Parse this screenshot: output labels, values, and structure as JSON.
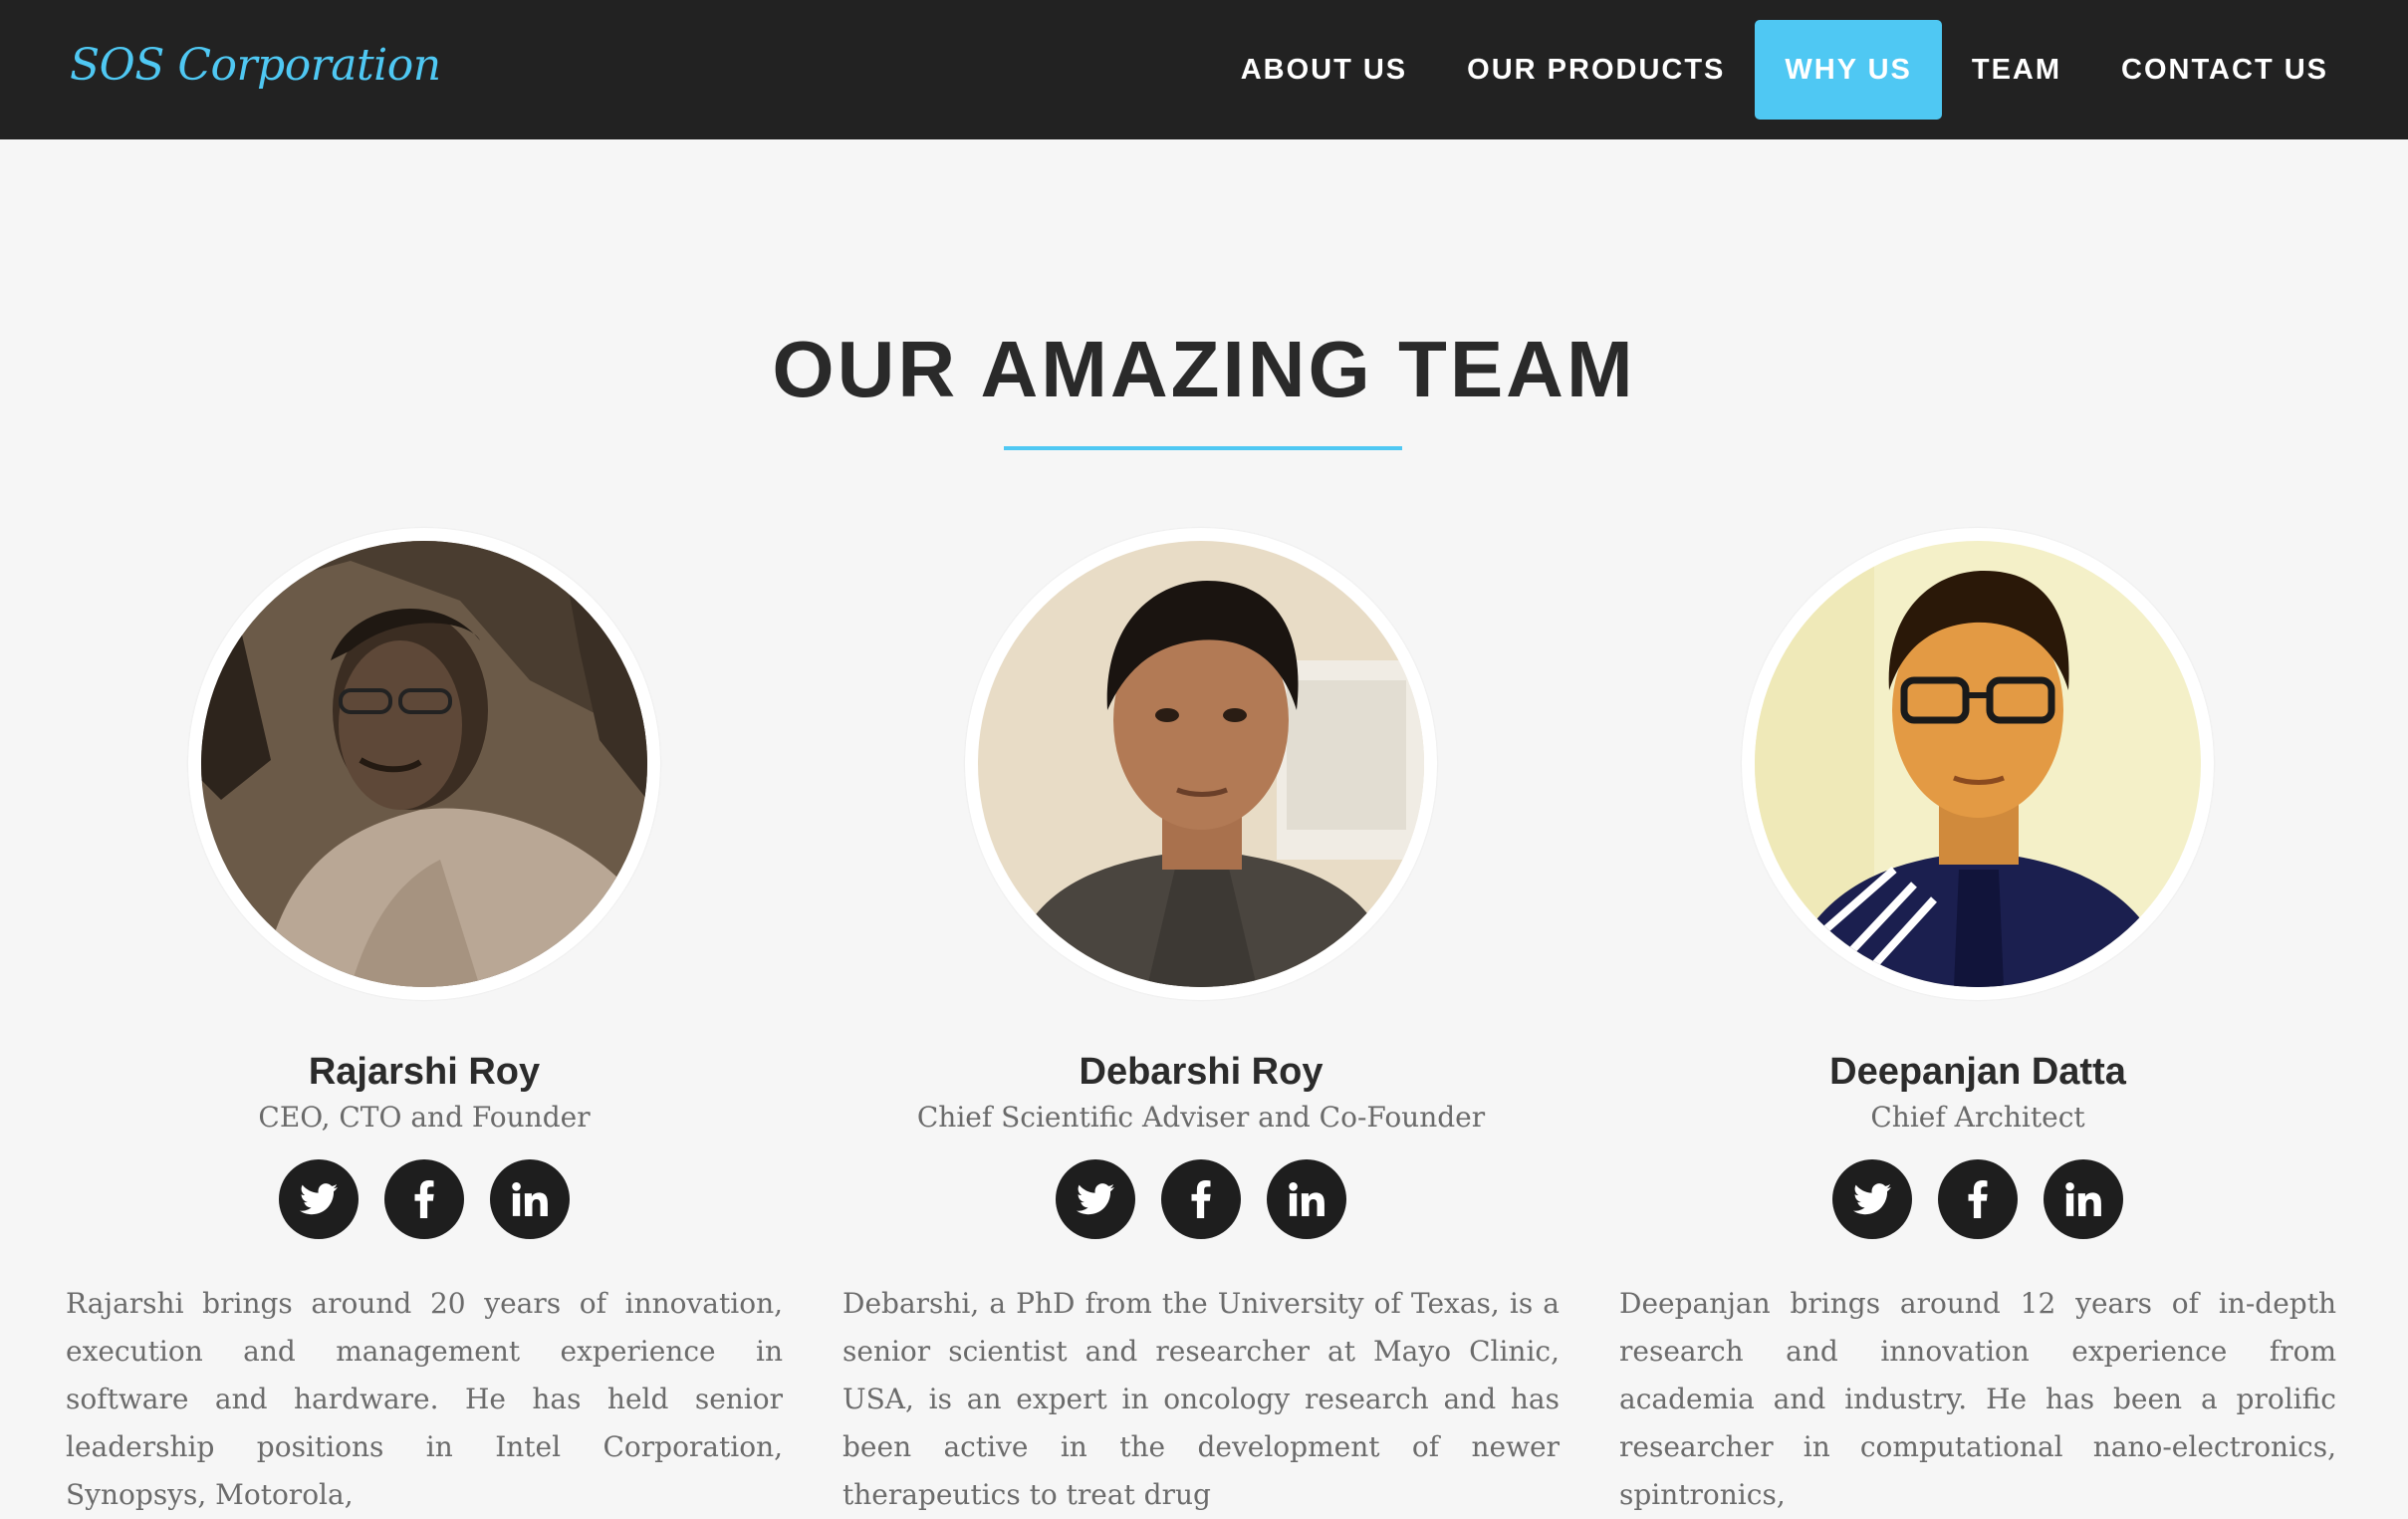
{
  "navbar": {
    "brand": "SOS Corporation",
    "items": [
      {
        "label": "ABOUT US",
        "active": false
      },
      {
        "label": "OUR PRODUCTS",
        "active": false
      },
      {
        "label": "WHY US",
        "active": true
      },
      {
        "label": "TEAM",
        "active": false
      },
      {
        "label": "CONTACT US",
        "active": false
      }
    ]
  },
  "section": {
    "title": "OUR AMAZING TEAM"
  },
  "colors": {
    "accent": "#4fc8f3",
    "navbar_bg": "#222222",
    "page_bg": "#f6f6f6",
    "social_bg": "#1e1e1e"
  },
  "team": [
    {
      "name": "Rajarshi Roy",
      "role": "CEO, CTO and Founder",
      "photo_icon": "person-photo",
      "socials": [
        "twitter-icon",
        "facebook-icon",
        "linkedin-icon"
      ],
      "bio": "Rajarshi brings around 20 years of innovation, execution and management experience in software and hardware. He has held senior leadership positions in Intel Corporation, Synopsys, Motorola,"
    },
    {
      "name": "Debarshi Roy",
      "role": "Chief Scientific Adviser and Co-Founder",
      "photo_icon": "person-photo",
      "socials": [
        "twitter-icon",
        "facebook-icon",
        "linkedin-icon"
      ],
      "bio": "Debarshi, a PhD from the University of Texas, is a senior scientist and researcher at Mayo Clinic, USA, is an expert in oncology research and has been active in the development of newer therapeutics to treat drug"
    },
    {
      "name": "Deepanjan Datta",
      "role": "Chief Architect",
      "photo_icon": "person-photo",
      "socials": [
        "twitter-icon",
        "facebook-icon",
        "linkedin-icon"
      ],
      "bio": "Deepanjan brings around 12 years of in-depth research and innovation experience from academia and industry. He has been a prolific researcher in computational nano-electronics, spintronics,"
    }
  ]
}
